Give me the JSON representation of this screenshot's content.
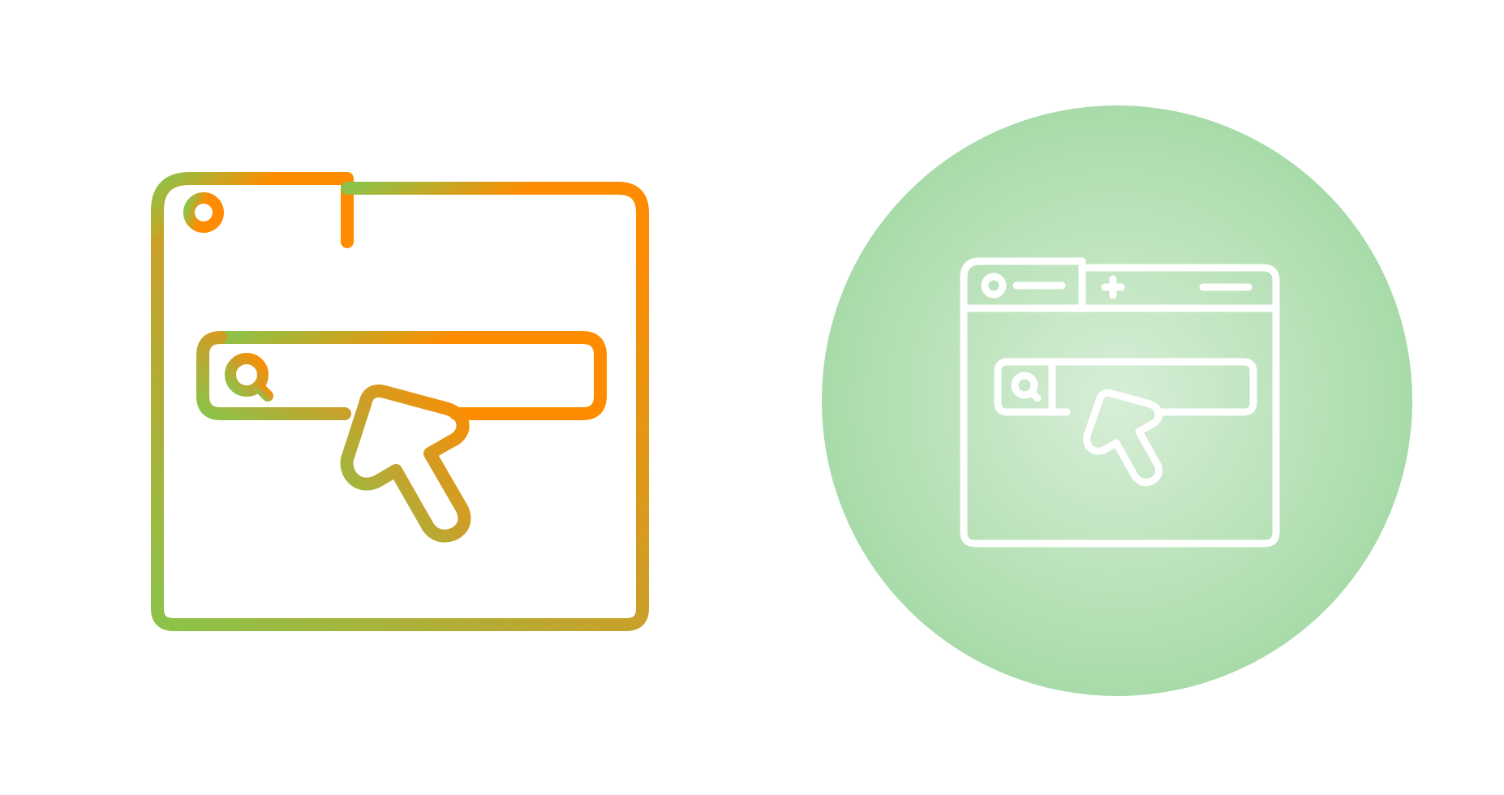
{
  "icons": [
    {
      "name": "search-browser-cursor-icon",
      "style": "gradient-outline",
      "colors": {
        "start": "#8bc34a",
        "end": "#ff8c00"
      }
    },
    {
      "name": "search-browser-cursor-icon",
      "style": "white-outline-on-circle",
      "colors": {
        "stroke": "#ffffff",
        "circle_center": "#d8eed7",
        "circle_edge": "#a8dba9"
      }
    }
  ]
}
